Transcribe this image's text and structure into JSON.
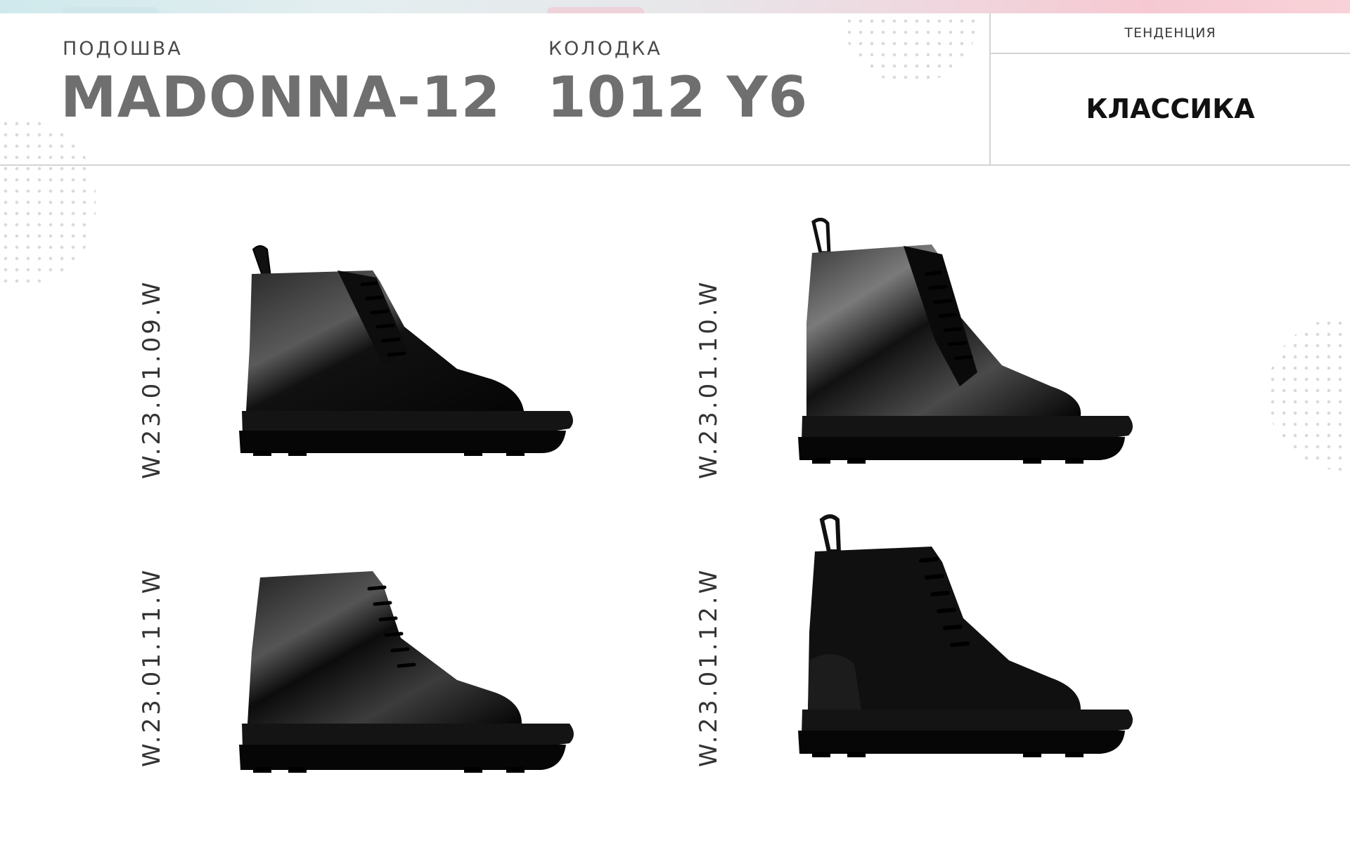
{
  "header": {
    "sole_label": "ПОДОШВА",
    "sole_value": "MADONNA-12",
    "last_label": "КОЛОДКА",
    "last_value": "1012 Y6",
    "trend_label": "ТЕНДЕНЦИЯ",
    "trend_value": "КЛАССИКА"
  },
  "products": [
    {
      "article": "W.23.01.09.W",
      "material": "patent leather"
    },
    {
      "article": "W.23.01.10.W",
      "material": "patent leather"
    },
    {
      "article": "W.23.01.11.W",
      "material": "patent leather"
    },
    {
      "article": "W.23.01.12.W",
      "material": "suede"
    }
  ],
  "colors": {
    "ribbon_start": "#cfe9ec",
    "ribbon_end": "#f6c9d2",
    "title_gray": "#6f6f6f",
    "boot_black": "#0b0b0b"
  }
}
